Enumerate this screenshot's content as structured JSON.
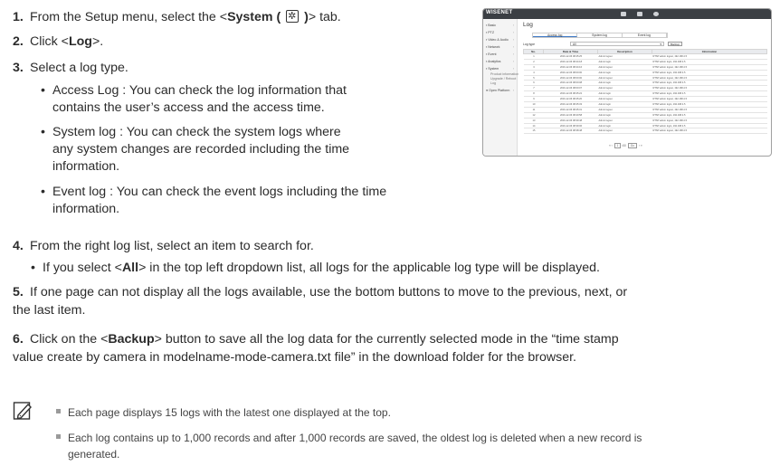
{
  "steps": [
    {
      "num": "1.",
      "pre": "From the Setup menu, select the <",
      "bold": "System (",
      "bold_after": ")",
      "post": "> tab."
    },
    {
      "num": "2.",
      "pre": "Click <",
      "bold": "Log",
      "post": ">."
    },
    {
      "num": "3.",
      "text": "Select a log type."
    },
    {
      "num": "4.",
      "text": "From the right log list, select an item to search for."
    },
    {
      "num": "5.",
      "line1": "If one page can not display all the logs available, use the bottom buttons to move to the previous, next, or",
      "line2": "the last item."
    },
    {
      "num": "6.",
      "pre": "Click on the <",
      "bold": "Backup",
      "post": "> button to save all the log data for the currently selected mode in the “time stamp",
      "line2": "value create by camera in modelname-mode-camera.txt file” in the download folder for the browser."
    }
  ],
  "bullets3": [
    {
      "lines": [
        "Access Log : You can check the log information that",
        "contains the user’s access and the access time."
      ]
    },
    {
      "lines": [
        "System log : You can check the system logs where",
        "any system changes are recorded including the time",
        "information."
      ]
    },
    {
      "lines": [
        "Event log : You can check the event logs including the time",
        "information."
      ]
    }
  ],
  "bullet4": {
    "pre": "If you select <",
    "bold": "All",
    "post": "> in the top left dropdown list, all logs for the applicable log type will be displayed."
  },
  "notes": [
    {
      "lines": [
        "Each page displays 15 logs with the latest one displayed at the top."
      ]
    },
    {
      "lines": [
        "Each log contains up to 1,000 records and after 1,000 records are saved, the oldest log is deleted when a new record is",
        "generated."
      ]
    }
  ],
  "screenshot": {
    "logo": "WISENET",
    "sidebar": [
      "Basic",
      "PTZ",
      "Video & Audio",
      "Network",
      "Event",
      "Analytics",
      "System"
    ],
    "sidebar_sub": [
      "Product information",
      "Upgrade / Reboot",
      "Log"
    ],
    "sidebar_extra": "Open Platform",
    "title": "Log",
    "tabs": [
      "Access log",
      "System log",
      "Event log"
    ],
    "log_type_label": "Log type",
    "select_value": "All",
    "backup": "Backup",
    "headers": [
      "No.",
      "Date & Time",
      "Description",
      "Information"
    ],
    "rows": [
      [
        "1",
        "2016-12-06 08:45:25",
        "Admin logout",
        "RTSP admin logout, 192.168.4.5"
      ],
      [
        "2",
        "2016-12-06 08:44:18",
        "Admin login",
        "RTSP admin login, 192.168.4.5"
      ],
      [
        "3",
        "2016-12-06 08:44:16",
        "Admin logout",
        "RTSP admin logout, 192.168.4.5"
      ],
      [
        "4",
        "2016-12-06 08:00:00",
        "Admin login",
        "RTSP admin login, 192.168.4.5"
      ],
      [
        "5",
        "2016-12-06 08:00:00",
        "Admin logout",
        "RTSP admin logout, 192.168.4.5"
      ],
      [
        "6",
        "2016-12-06 08:00:08",
        "Admin login",
        "RTSP admin login, 192.168.4.5"
      ],
      [
        "7",
        "2016-12-06 08:00:07",
        "Admin logout",
        "RTSP admin logout, 192.168.4.5"
      ],
      [
        "8",
        "2016-12-06 08:45:22",
        "Admin login",
        "RTSP admin login, 192.168.4.5"
      ],
      [
        "9",
        "2016-12-06 08:45:20",
        "Admin logout",
        "RTSP admin logout, 192.168.4.5"
      ],
      [
        "10",
        "2016-12-06 08:45:33",
        "Admin login",
        "RTSP admin login, 192.168.4.5"
      ],
      [
        "11",
        "2016-12-06 08:45:31",
        "Admin logout",
        "RTSP admin logout, 192.168.4.5"
      ],
      [
        "12",
        "2016-12-06 08:40:58",
        "Admin login",
        "RTSP admin login, 192.168.4.5"
      ],
      [
        "13",
        "2016-12-06 08:39:48",
        "Admin logout",
        "RTSP admin logout, 192.168.4.5"
      ],
      [
        "14",
        "2016-12-06 08:39:06",
        "Admin login",
        "RTSP admin login, 192.168.4.5"
      ],
      [
        "15",
        "2016-12-06 08:38:48",
        "Admin logout",
        "RTSP admin logout, 192.168.4.5"
      ]
    ],
    "pager": [
      "«",
      "‹",
      "1",
      "/40",
      "Go",
      "›",
      "»"
    ]
  },
  "icons": {
    "note": "note-pencil-icon",
    "gear": "gear-icon"
  }
}
